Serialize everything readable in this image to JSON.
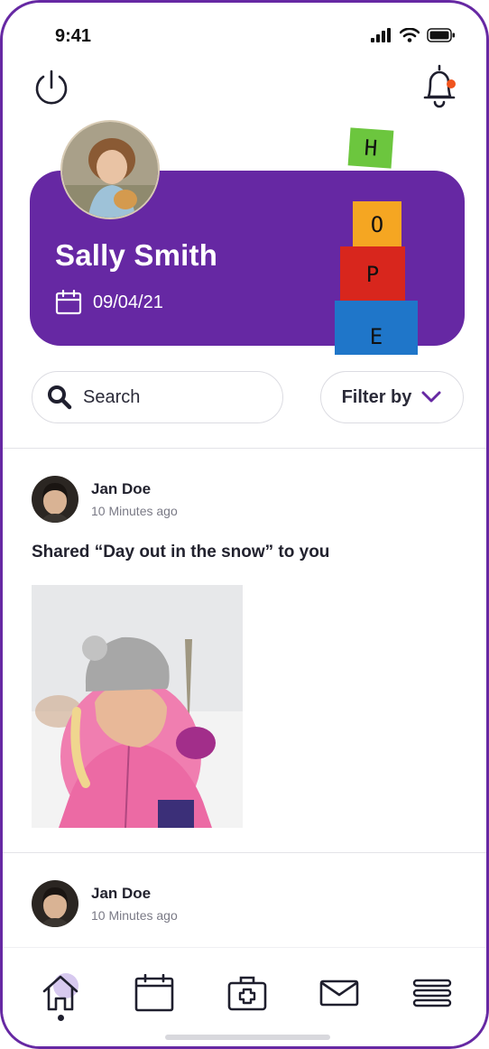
{
  "status_bar": {
    "time": "9:41"
  },
  "profile": {
    "name": "Sally Smith",
    "date": "09/04/21"
  },
  "hope_letters": [
    "H",
    "O",
    "P",
    "E"
  ],
  "search": {
    "label": "Search"
  },
  "filter": {
    "label": "Filter by"
  },
  "feed": [
    {
      "author": "Jan Doe",
      "time": "10 Minutes ago",
      "text": "Shared “Day out in the snow” to you"
    },
    {
      "author": "Jan Doe",
      "time": "10 Minutes ago"
    }
  ],
  "nav": {
    "items": [
      "home-icon",
      "calendar-icon",
      "medical-kit-icon",
      "mail-icon",
      "menu-icon"
    ],
    "active": 0
  },
  "colors": {
    "brand": "#6628a3",
    "notification": "#f0541e"
  }
}
